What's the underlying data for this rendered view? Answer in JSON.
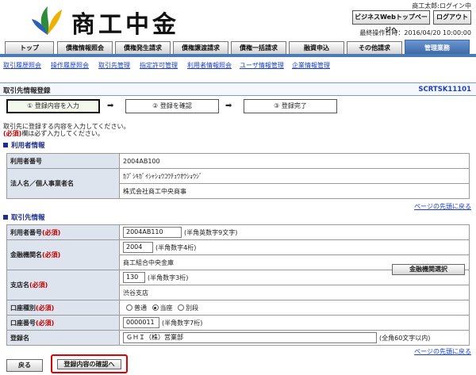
{
  "header": {
    "logo_text": "商工中金",
    "user_status": "商工太郎:ログイン中",
    "webtop_label": "ビジネスWebトップページへ",
    "logout_label": "ログアウト",
    "last_operation": "最終操作日時：2016/04/20 10:00:00"
  },
  "tabs": [
    "トップ",
    "債権情報照会",
    "債権発生請求",
    "債権譲渡請求",
    "債権一括請求",
    "融資申込",
    "その他請求",
    "管理業務"
  ],
  "subnav": [
    "取引履歴照会",
    "操作履歴照会",
    "取引先管理",
    "指定許可管理",
    "利用者情報照会",
    "ユーザ情報管理",
    "企業情報管理"
  ],
  "page": {
    "title": "取引先情報登録",
    "screen_code": "SCRTSK11101"
  },
  "steps": [
    "① 登録内容を入力",
    "② 登録を確認",
    "③ 登録完了"
  ],
  "arrow": "➡",
  "notes": {
    "line1": "取引先に登録する内容を入力してください。",
    "req_mark": "(必須)",
    "line2": "欄は必ず入力してください。"
  },
  "user_section": {
    "heading": "利用者情報",
    "user_no_label": "利用者番号",
    "user_no": "2004AB100",
    "name_label": "法人名／個人事業者名",
    "name_kana": "ｶﾌﾞｼｷｶﾞｲｼｬｼｮｳｺｳﾁｭｳｵｳｼｮｳｼﾞ",
    "name": "株式会社商工中央商事"
  },
  "page_top_link": "ページの先頭に戻る",
  "client_section": {
    "heading": "取引先情報",
    "required": "(必須)",
    "user_no_label": "利用者番号",
    "user_no_value": "2004AB110",
    "user_no_hint": "(半角英数字9文字)",
    "bank_label": "金融機関名",
    "bank_code": "2004",
    "bank_code_hint": "(半角数字4桁)",
    "bank_name": "商工組合中央金庫",
    "bank_select_label": "金融機関選択",
    "branch_label": "支店名",
    "branch_code": "130",
    "branch_code_hint": "(半角数字3桁)",
    "branch_name": "渋谷支店",
    "account_type_label": "口座種別",
    "account_types": [
      "普通",
      "当座",
      "別段"
    ],
    "account_no_label": "口座番号",
    "account_no": "0000011",
    "account_no_hint": "(半角数字7桁)",
    "reg_name_label": "登録名",
    "reg_name": "ＧＨＩ（株）営業部",
    "reg_name_hint": "(全角60文字以内)"
  },
  "footer": {
    "back_label": "戻る",
    "confirm_label": "登録内容の確認へ"
  },
  "colors": {
    "accent_blue": "#4a7ab8",
    "label_bg": "#dde4ee",
    "required_red": "#c00000",
    "link_blue": "#1a3ec9",
    "highlight_red": "#e00000"
  }
}
